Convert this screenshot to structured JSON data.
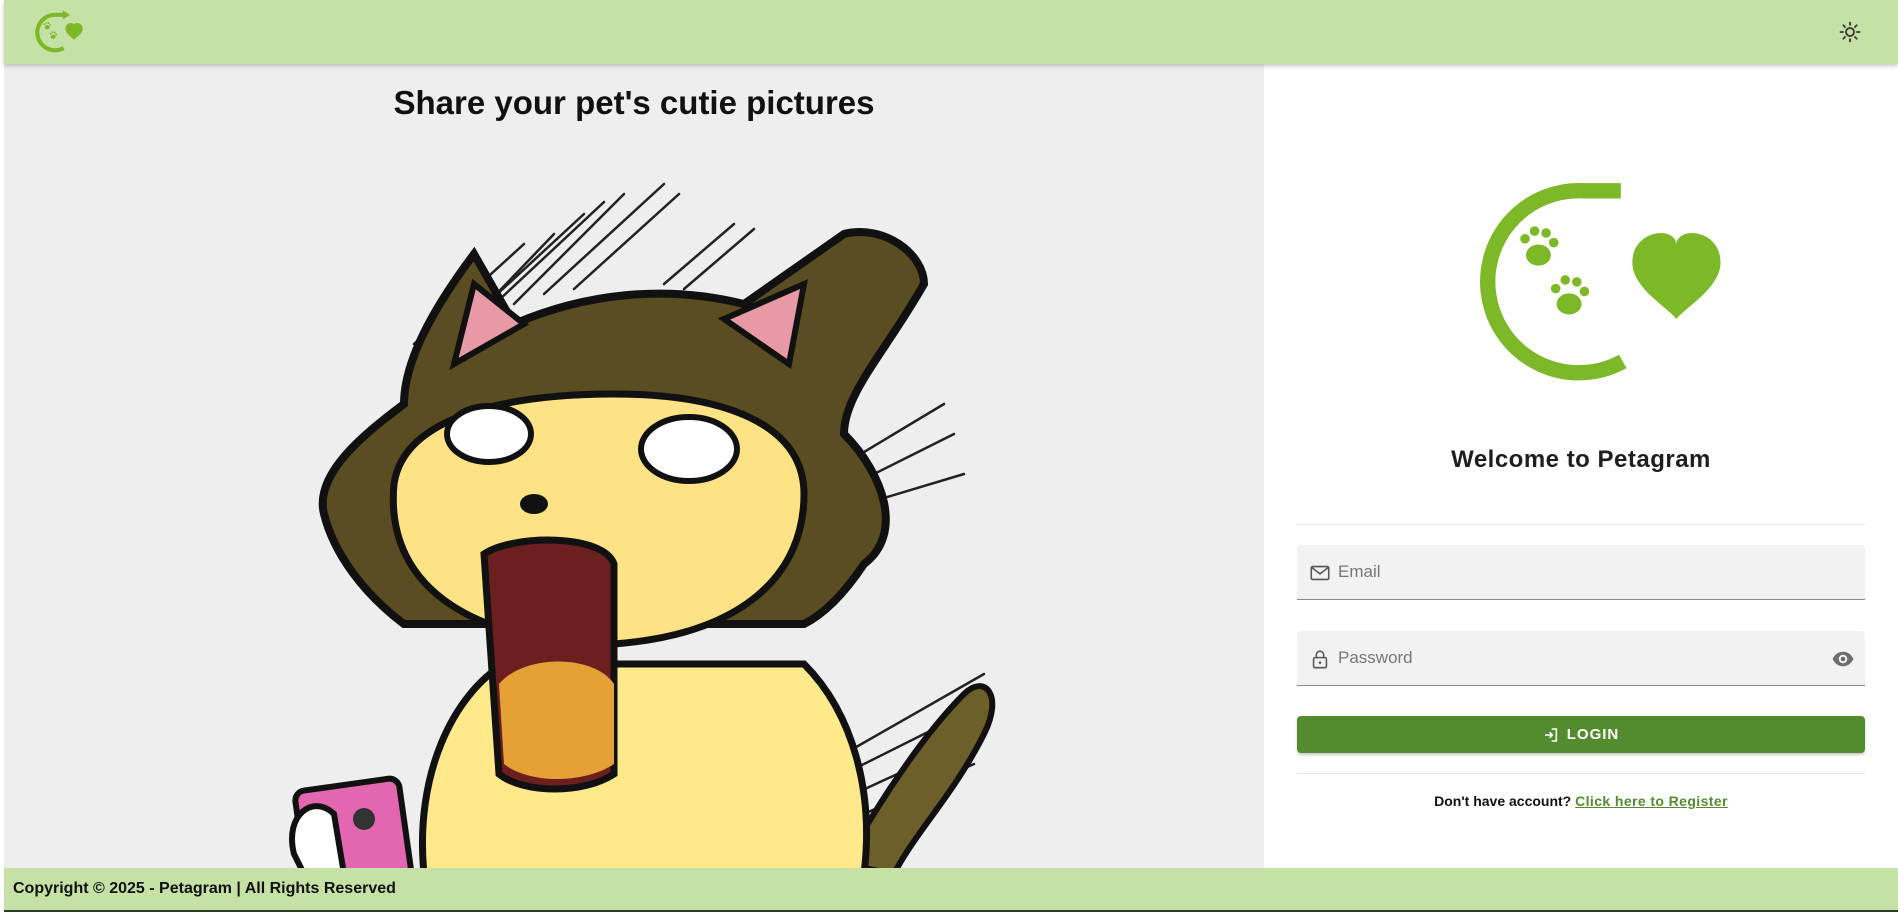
{
  "header": {
    "logo_icon": "petagram-logo-icon",
    "theme_icon": "sun-icon"
  },
  "hero": {
    "title": "Share your pet's cutie pictures",
    "illustration": "shocked-cat-with-phone"
  },
  "login": {
    "welcome": "Welcome to Petagram",
    "email_placeholder": "Email",
    "email_icon": "mail-icon",
    "password_placeholder": "Password",
    "password_icon": "lock-icon",
    "password_toggle_icon": "eye-icon",
    "button_label": "LOGIN",
    "button_icon": "login-icon",
    "register_prompt": "Don't have account?",
    "register_link": "Click here to Register"
  },
  "footer": {
    "text": "Copyright © 2025 - Petagram | All Rights Reserved"
  },
  "colors": {
    "header_bg": "#c5e1a5",
    "brand_green": "#7cb827",
    "button_green": "#558b2f",
    "panel_gray": "#eeeeee"
  }
}
